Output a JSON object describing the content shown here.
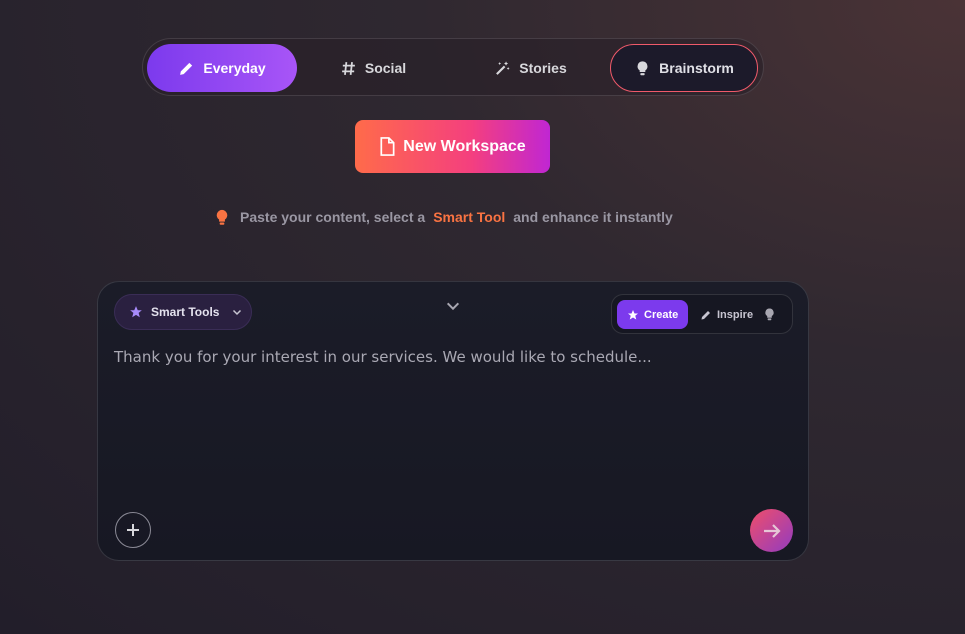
{
  "tabs": [
    {
      "label": "Everyday",
      "icon": "pencil-icon"
    },
    {
      "label": "Social",
      "icon": "hash-icon"
    },
    {
      "label": "Stories",
      "icon": "magic-wand-icon"
    },
    {
      "label": "Brainstorm",
      "icon": "lightbulb-icon"
    }
  ],
  "new_workspace": {
    "label": "New Workspace",
    "icon": "document-icon"
  },
  "hint": {
    "before": "Paste your content, select a",
    "accent": "Smart Tool",
    "after": "and enhance it instantly",
    "icon": "lightbulb-icon"
  },
  "editor": {
    "smart_tools_label": "Smart Tools",
    "modes": [
      {
        "label": "Create",
        "icon": "star-icon"
      },
      {
        "label": "Inspire",
        "icon": "pencil-icon"
      },
      {
        "label": "",
        "icon": "lightbulb-icon"
      }
    ],
    "content": "Thank you for your interest in our services. We would like to schedule..."
  },
  "colors": {
    "accent_purple": "#7c3aed",
    "accent_orange": "#f97342",
    "brand_gradient_start": "#ff6b4a",
    "brand_gradient_end": "#c026d3"
  }
}
